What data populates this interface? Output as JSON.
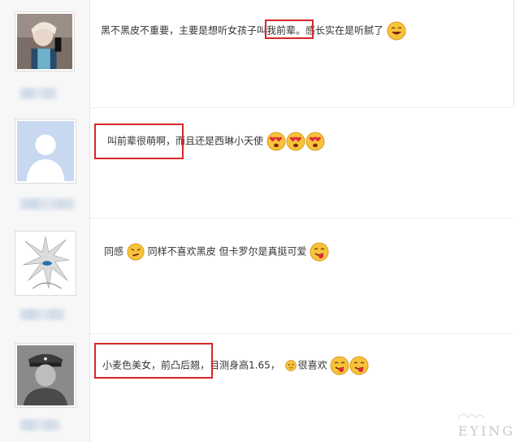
{
  "comments": [
    {
      "text_before": "黑不黑皮不重要，主要是想听女孩子叫",
      "highlight": "我前辈。",
      "text_after": "感长实在是听腻了",
      "emojis": [
        "grin-emoji"
      ]
    },
    {
      "highlight": "叫前辈很萌啊，",
      "text_after": "而且还是西琳小天使",
      "emojis": [
        "heart-eyes-emoji",
        "heart-eyes-emoji",
        "heart-eyes-emoji"
      ]
    },
    {
      "text_before": "同感",
      "text_after": "同样不喜欢黑皮 但卡罗尔是真挺可爱",
      "emojis": [
        "tongue-emoji"
      ]
    },
    {
      "highlight": "小麦色美女，前凸后翘，",
      "text_after": "目测身高1.65，",
      "text_tail": "很喜欢",
      "emojis": [
        "tongue-emoji",
        "tongue-emoji"
      ]
    }
  ],
  "watermark": {
    "text": "EYING"
  },
  "colors": {
    "highlight_box": "#d9262a",
    "text": "#333333"
  }
}
